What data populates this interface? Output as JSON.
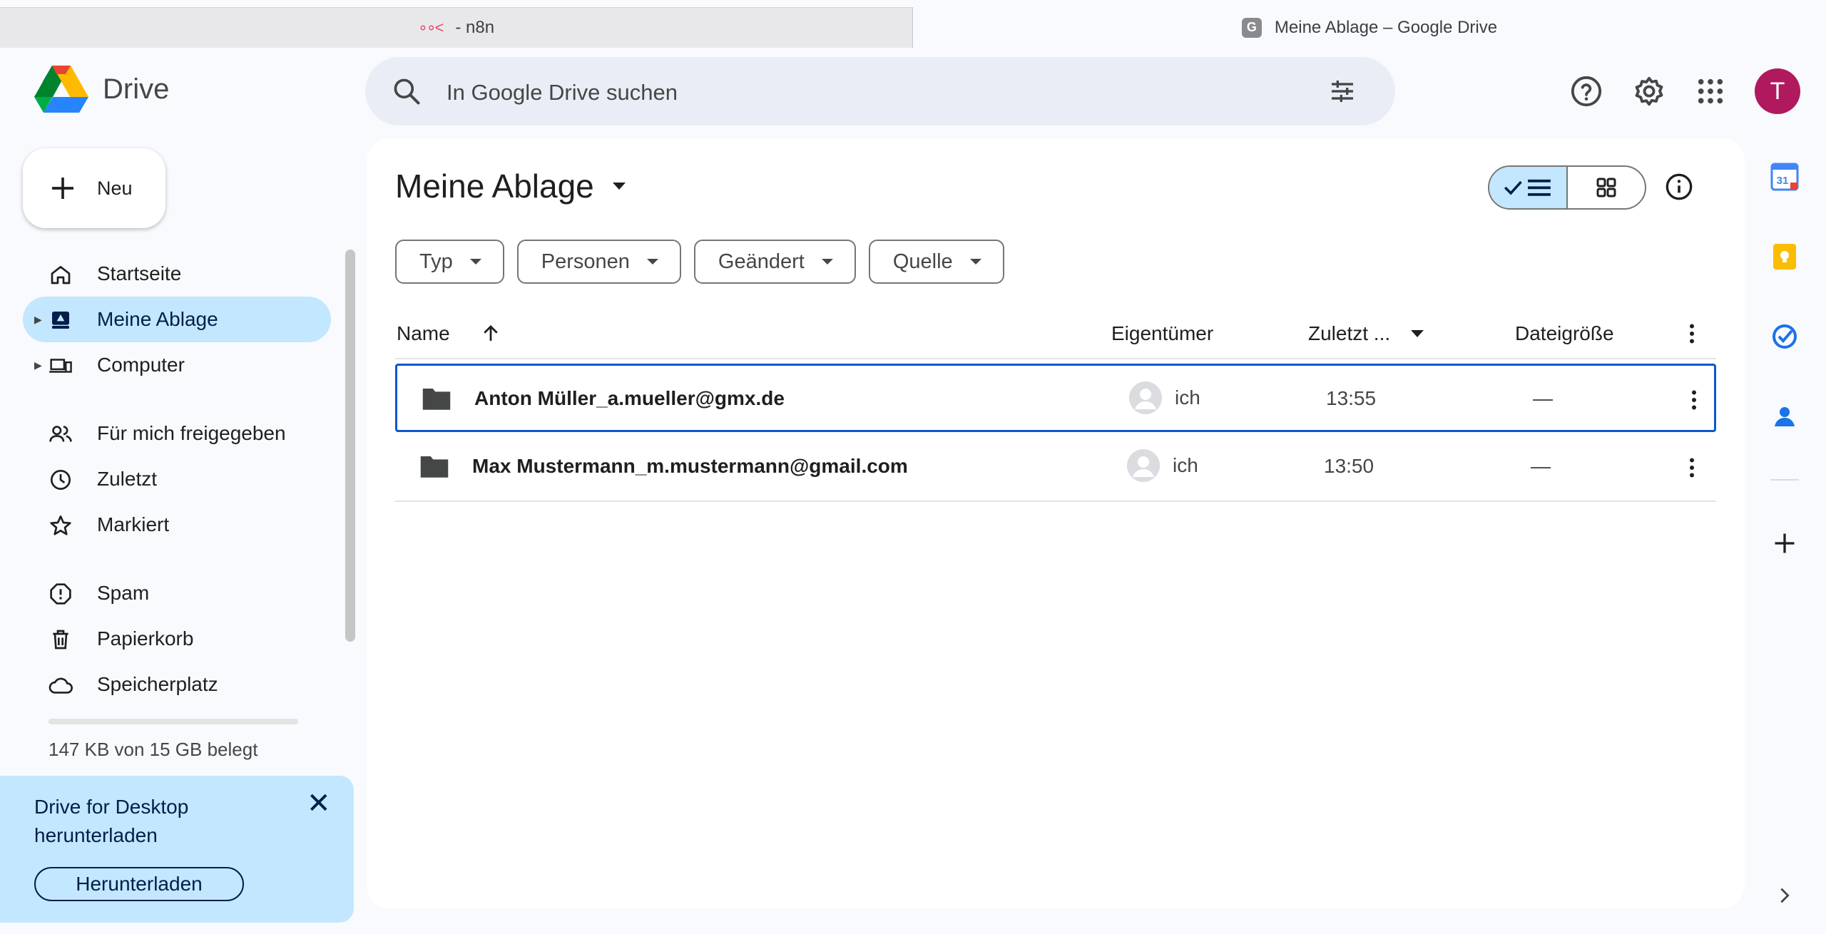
{
  "browser": {
    "tabs": [
      {
        "label": "- n8n",
        "icon": "n8n-icon",
        "active": false
      },
      {
        "label": "Meine Ablage – Google Drive",
        "icon": "g-icon",
        "icon_letter": "G",
        "active": true
      }
    ]
  },
  "header": {
    "app_name": "Drive",
    "search_placeholder": "In Google Drive suchen",
    "icons": [
      "help-icon",
      "settings-icon",
      "apps-icon"
    ],
    "avatar_letter": "T",
    "avatar_color": "#b0195e"
  },
  "sidebar": {
    "new_label": "Neu",
    "items": [
      {
        "label": "Startseite",
        "icon": "home-icon"
      },
      {
        "label": "Meine Ablage",
        "icon": "my-drive-icon",
        "selected": true,
        "expandable": true
      },
      {
        "label": "Computer",
        "icon": "computer-icon",
        "expandable": true
      },
      {
        "label": "Für mich freigegeben",
        "icon": "shared-icon"
      },
      {
        "label": "Zuletzt",
        "icon": "clock-icon"
      },
      {
        "label": "Markiert",
        "icon": "star-icon"
      },
      {
        "label": "Spam",
        "icon": "spam-icon"
      },
      {
        "label": "Papierkorb",
        "icon": "trash-icon"
      },
      {
        "label": "Speicherplatz",
        "icon": "cloud-icon"
      }
    ],
    "storage_text": "147 KB von 15 GB belegt",
    "storage_fraction": 1e-05
  },
  "promo": {
    "title": "Drive for Desktop herunterladen",
    "button": "Herunterladen"
  },
  "main": {
    "title": "Meine Ablage",
    "filters": [
      "Typ",
      "Personen",
      "Geändert",
      "Quelle"
    ],
    "columns": {
      "name": "Name",
      "owner": "Eigentümer",
      "modified": "Zuletzt ...",
      "size": "Dateigröße"
    },
    "rows": [
      {
        "name": "Anton Müller_a.mueller@gmx.de",
        "owner": "ich",
        "modified": "13:55",
        "size": "—",
        "selected": true
      },
      {
        "name": "Max Mustermann_m.mustermann@gmail.com",
        "owner": "ich",
        "modified": "13:50",
        "size": "—"
      }
    ]
  },
  "rail": {
    "icons": [
      "calendar-icon",
      "keep-icon",
      "tasks-icon",
      "contacts-icon",
      "add-icon"
    ],
    "calendar_day": "31"
  },
  "colors": {
    "accent": "#0b57d0",
    "selected_bg": "#c2e7ff",
    "search_bg": "#e9eef6"
  }
}
